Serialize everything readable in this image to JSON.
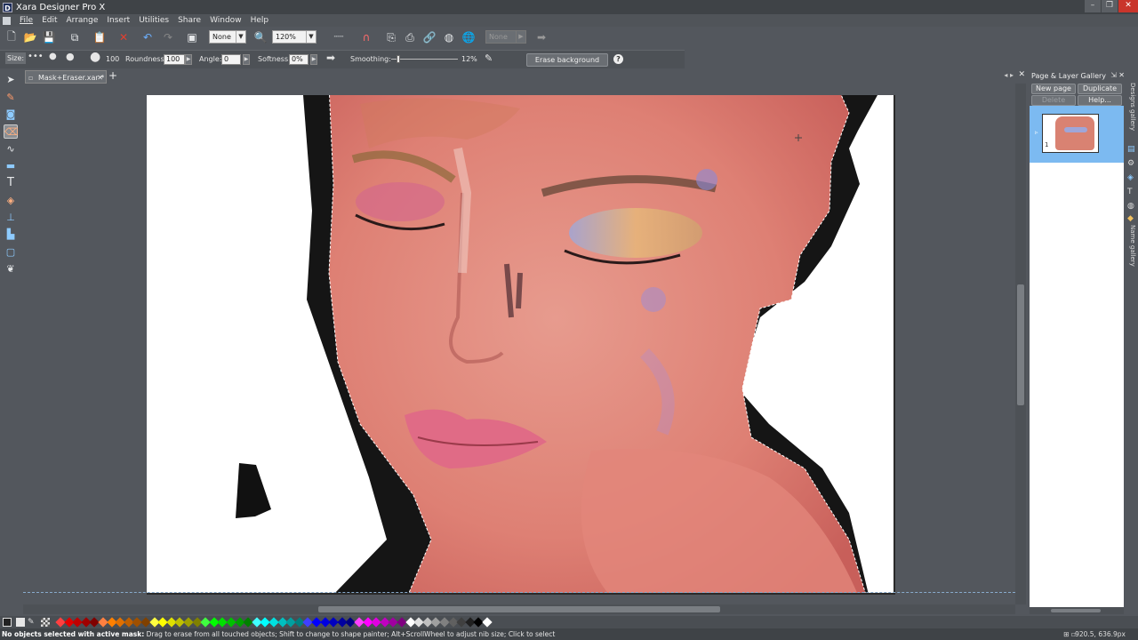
{
  "app": {
    "title": "Xara Designer Pro X",
    "logo_letter": "D"
  },
  "menu": [
    "File",
    "Edit",
    "Arrange",
    "Insert",
    "Utilities",
    "Share",
    "Window",
    "Help"
  ],
  "toolbar": {
    "quality_select": "None",
    "zoom_select": "120%",
    "disabled_select": "None"
  },
  "brush_bar": {
    "size_label": "Size:",
    "size_value": "100",
    "roundness_label": "Roundness:",
    "roundness_value": "100",
    "angle_label": "Angle:",
    "angle_value": "0",
    "softness_label": "Softness:",
    "softness_value": "0%",
    "smoothing_label": "Smoothing:",
    "smoothing_value": "12%",
    "erase_background_label": "Erase background",
    "help_glyph": "?"
  },
  "document_tab": {
    "name": "Mask+Eraser.xar *",
    "add_glyph": "+"
  },
  "right_panel": {
    "title": "Page & Layer Gallery",
    "new_page": "New page",
    "duplicate": "Duplicate",
    "delete": "Delete",
    "help": "Help...",
    "page_number": "1"
  },
  "vertical_tabs": [
    "Designs gallery",
    "Name gallery"
  ],
  "status": {
    "bold_text": "No objects selected with active mask:",
    "message": " Drag to erase from all touched objects; Shift to change to shape painter; Alt+ScrollWheel to adjust nib size; Click to select",
    "coords": "920.5, 636.9px"
  },
  "palette_colors": [
    "#ff4040",
    "#e00000",
    "#c00000",
    "#a00000",
    "#800000",
    "#ff8040",
    "#ff8000",
    "#e07000",
    "#c06000",
    "#a05000",
    "#804000",
    "#ffff40",
    "#ffff00",
    "#e0e000",
    "#c0c000",
    "#a0a000",
    "#808000",
    "#40ff40",
    "#00ff00",
    "#00e000",
    "#00c000",
    "#00a000",
    "#008000",
    "#40ffff",
    "#00ffff",
    "#00e0e0",
    "#00c0c0",
    "#00a0a0",
    "#008080",
    "#4040ff",
    "#0000ff",
    "#0000e0",
    "#0000c0",
    "#0000a0",
    "#000080",
    "#ff40ff",
    "#ff00ff",
    "#e000e0",
    "#c000c0",
    "#a000a0",
    "#800080",
    "#ffffff",
    "#e0e0e0",
    "#c0c0c0",
    "#a0a0a0",
    "#808080",
    "#606060",
    "#404040",
    "#202020",
    "#000000",
    "#ffffff"
  ]
}
